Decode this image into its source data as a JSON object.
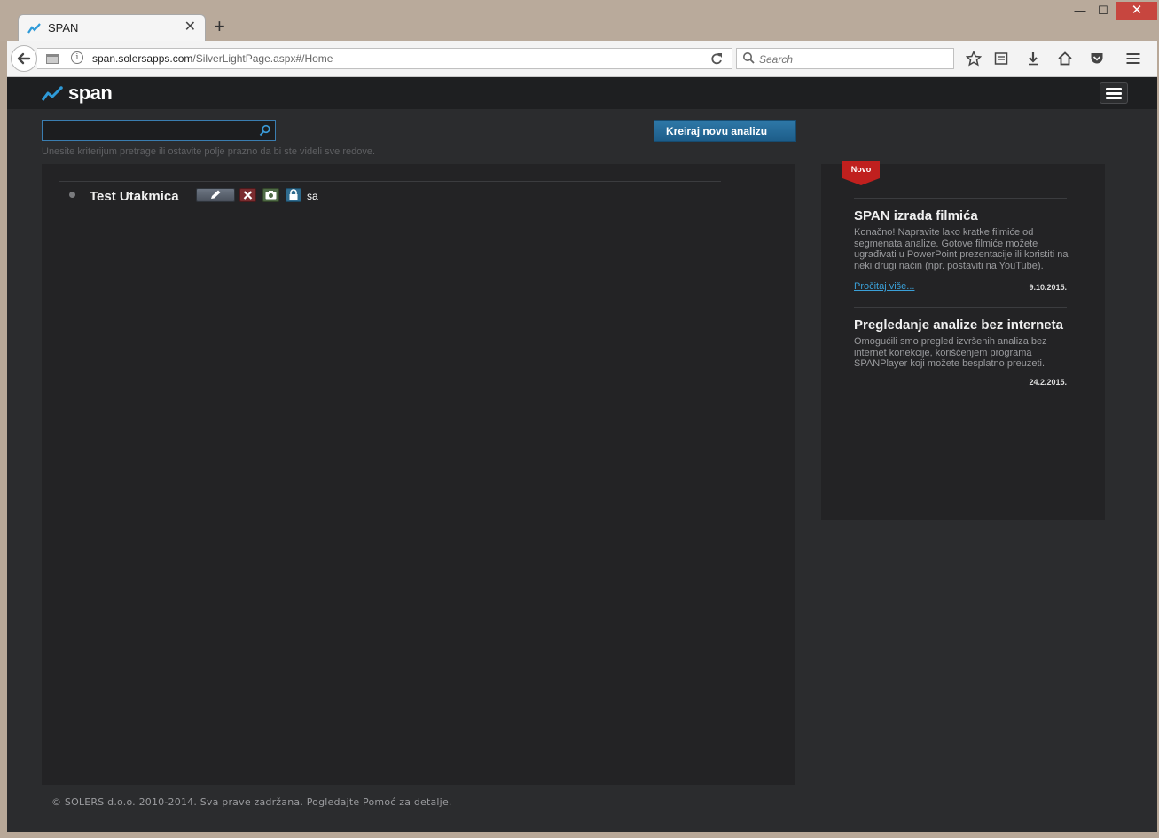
{
  "browser": {
    "tab_title": "SPAN",
    "tab_close": "✕",
    "new_tab": "+",
    "url_host": "span.solersapps.com",
    "url_prefix": "",
    "url_path": "/SilverLightPage.aspx#/Home",
    "search_placeholder": "Search",
    "win_min": "—",
    "win_max": "☐",
    "win_close": "✕"
  },
  "app": {
    "logo_text": "span",
    "search": {
      "value": "",
      "hint": "Unesite kriterijum pretrage ili ostavite polje prazno da bi ste videli sve redove."
    },
    "create_button": "Kreiraj novu analizu",
    "analyses": [
      {
        "title": "Test Utakmica",
        "user": "sa"
      }
    ],
    "news": {
      "ribbon": "Novo",
      "items": [
        {
          "title": "SPAN izrada filmića",
          "body": "Konačno! Napravite lako kratke filmiće od segmenata analize. Gotove filmiće možete ugrađivati u PowerPoint prezentacije ili koristiti na neki drugi način (npr. postaviti na YouTube).",
          "link": "Pročitaj više...",
          "date": "9.10.2015."
        },
        {
          "title": "Pregledanje analize bez interneta",
          "body": "Omogućili smo pregled izvršenih analiza bez internet konekcije, korišćenjem programa SPANPlayer koji možete besplatno preuzeti.",
          "date": "24.2.2015."
        }
      ]
    },
    "footer": "© SOLERS d.o.o. 2010-2014. Sva prave zadržana. Pogledajte Pomoć za detalje."
  },
  "colors": {
    "accent": "#2e78a8",
    "page_bg": "#2b2c2e",
    "panel_bg": "#232325",
    "ribbon": "#c0201e"
  }
}
